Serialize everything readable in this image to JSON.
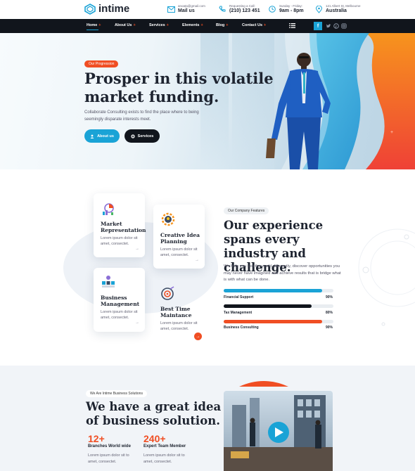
{
  "brand": {
    "name": "intime"
  },
  "header_info": [
    {
      "small": "anoata@gmail.com",
      "big": "Mail us",
      "icon": "mail-icon"
    },
    {
      "small": "Requesting a Call:",
      "big": "(210) 123 451",
      "icon": "phone-icon"
    },
    {
      "small": "Sunday - Friday:",
      "big": "9am - 8pm",
      "icon": "clock-icon"
    },
    {
      "small": "121 Albert St, Melbourne",
      "big": "Australia",
      "icon": "location-pin-icon"
    }
  ],
  "nav": {
    "items": [
      {
        "label": "Home",
        "dot": "+"
      },
      {
        "label": "About Us",
        "dot": "+"
      },
      {
        "label": "Services",
        "dot": "+"
      },
      {
        "label": "Elements",
        "dot": "+"
      },
      {
        "label": "Blog",
        "dot": "+"
      },
      {
        "label": "Contact Us",
        "dot": "+"
      }
    ],
    "facebook": "f"
  },
  "hero": {
    "tag": "Our Progression",
    "title": "Prosper in this volatile market funding.",
    "description": "Collaborate Consulting exists to find the place where to being seemingly disparate interests meet.",
    "btn_about": "About us",
    "btn_services": "Services"
  },
  "features": {
    "cards": [
      {
        "title": "Market Representation",
        "desc": "Lorem ipsum dolor sit amet, consectet.",
        "arrow": "→"
      },
      {
        "title": "Creative Idea Planning",
        "desc": "Lorem ipsum dolor sit amet, consectet.",
        "arrow": "→"
      },
      {
        "title": "Business Management",
        "desc": "Lorem ipsum dolor sit amet, consectet.",
        "arrow": "→"
      },
      {
        "title": "Best Time Maintance",
        "desc": "Lorem ipsum dolor sit amet, consectet.",
        "arrow": "→"
      }
    ],
    "pill": "Our Company Features",
    "title": "Our experience spans every industry and challenge.",
    "description": "We help you see the world differently, discover opportunities you may never have imagined and achieve results that is bridge what is with what can be done.",
    "bars": [
      {
        "label": "Financial Support",
        "pct": "90%",
        "value": 90,
        "color": "#1aa3d6"
      },
      {
        "label": "Tax Management",
        "pct": "80%",
        "value": 80,
        "color": "#11151c"
      },
      {
        "label": "Business Consulting",
        "pct": "90%",
        "value": 90,
        "color": "#f04e23"
      }
    ]
  },
  "solutions": {
    "pill": "We Are Intime Business Solutions",
    "title": "We have a great idea of business solution.",
    "stats": [
      {
        "num": "12+",
        "label": "Branches World wide",
        "desc": "Lorem ipsum dolor sit to amet, consectet."
      },
      {
        "num": "240+",
        "label": "Expert Team Member",
        "desc": "Lorem ipsum dolor sit to amet, consectet."
      }
    ]
  },
  "colors": {
    "accent": "#1aa3d6",
    "orange": "#f04e23",
    "dark": "#11151c"
  }
}
